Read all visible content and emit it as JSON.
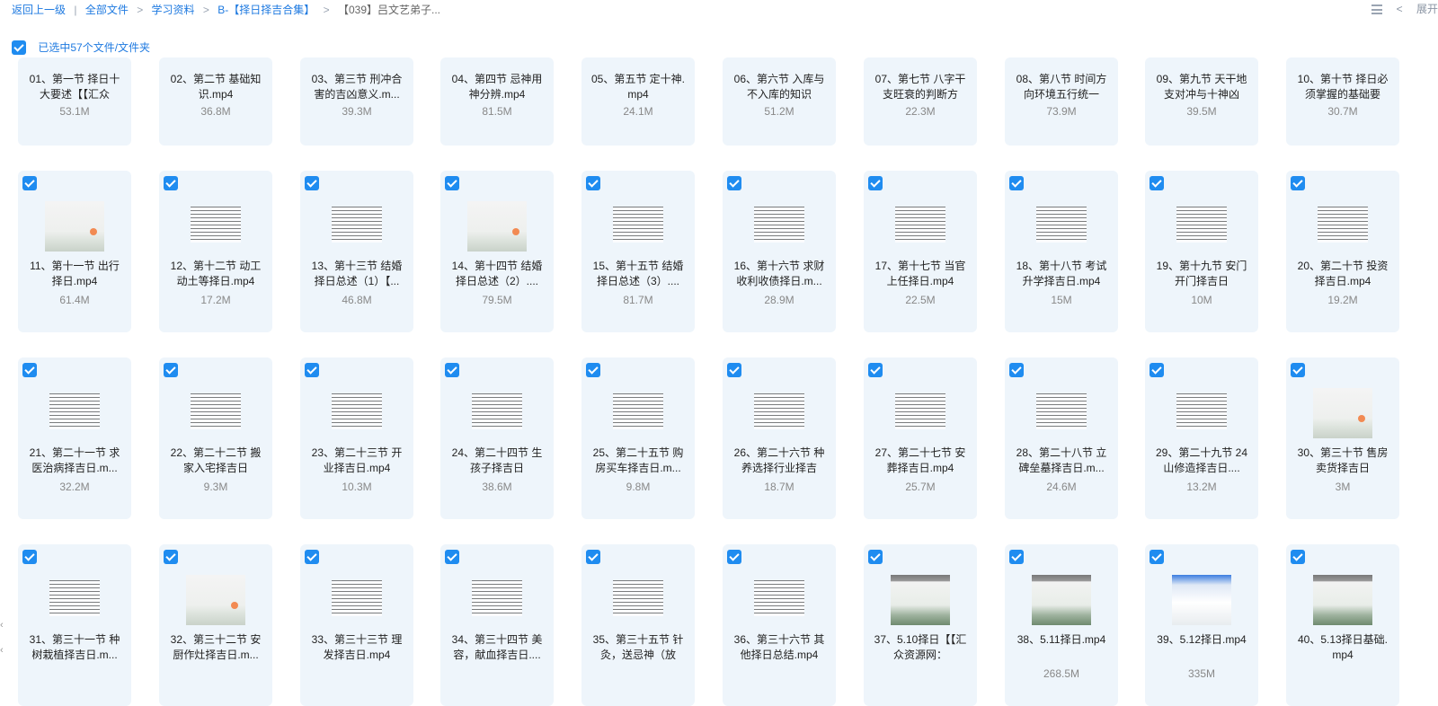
{
  "breadcrumb": {
    "back": "返回上一级",
    "items": [
      "全部文件",
      "学习资料",
      "B-【择日择吉合集】"
    ],
    "current": "【039】吕文艺弟子..."
  },
  "toolbar": {
    "back_arrow": "<",
    "expand": "展开"
  },
  "selection": {
    "text": "已选中57个文件/文件夹"
  },
  "colors": {
    "accent": "#1f7ae0",
    "card_bg": "#eef5fb",
    "checkbox": "#1f8cf0"
  },
  "files": [
    {
      "name": "01、第一节 择日十大要述【【汇众",
      "size": "53.1M",
      "thumb": "none"
    },
    {
      "name": "02、第二节 基础知识.mp4",
      "size": "36.8M",
      "thumb": "none"
    },
    {
      "name": "03、第三节 刑冲合害的吉凶意义.m...",
      "size": "39.3M",
      "thumb": "none"
    },
    {
      "name": "04、第四节 忌神用神分辨.mp4",
      "size": "81.5M",
      "thumb": "none"
    },
    {
      "name": "05、第五节 定十神.mp4",
      "size": "24.1M",
      "thumb": "none"
    },
    {
      "name": "06、第六节 入库与不入库的知识",
      "size": "51.2M",
      "thumb": "none"
    },
    {
      "name": "07、第七节 八字干支旺衰的判断方",
      "size": "22.3M",
      "thumb": "none"
    },
    {
      "name": "08、第八节 时间方向环境五行统一",
      "size": "73.9M",
      "thumb": "none"
    },
    {
      "name": "09、第九节 天干地支对冲与十神凶",
      "size": "39.5M",
      "thumb": "none"
    },
    {
      "name": "10、第十节 择日必须掌握的基础要",
      "size": "30.7M",
      "thumb": "none"
    },
    {
      "name": "11、第十一节 出行择日.mp4",
      "size": "61.4M",
      "thumb": "pic"
    },
    {
      "name": "12、第十二节 动工动土等择日.mp4",
      "size": "17.2M",
      "thumb": "text"
    },
    {
      "name": "13、第十三节 结婚择日总述（1）【...",
      "size": "46.8M",
      "thumb": "text"
    },
    {
      "name": "14、第十四节 结婚择日总述（2）....",
      "size": "79.5M",
      "thumb": "pic"
    },
    {
      "name": "15、第十五节 结婚择日总述（3）....",
      "size": "81.7M",
      "thumb": "text"
    },
    {
      "name": "16、第十六节 求财收利收债择日.m...",
      "size": "28.9M",
      "thumb": "text"
    },
    {
      "name": "17、第十七节 当官上任择日.mp4",
      "size": "22.5M",
      "thumb": "text"
    },
    {
      "name": "18、第十八节 考试升学择吉日.mp4",
      "size": "15M",
      "thumb": "text"
    },
    {
      "name": "19、第十九节 安门开门择吉日",
      "size": "10M",
      "thumb": "text"
    },
    {
      "name": "20、第二十节 投资择吉日.mp4",
      "size": "19.2M",
      "thumb": "text"
    },
    {
      "name": "21、第二十一节 求医治病择吉日.m...",
      "size": "32.2M",
      "thumb": "text"
    },
    {
      "name": "22、第二十二节 搬家入宅择吉日",
      "size": "9.3M",
      "thumb": "text"
    },
    {
      "name": "23、第二十三节 开业择吉日.mp4",
      "size": "10.3M",
      "thumb": "text"
    },
    {
      "name": "24、第二十四节 生孩子择吉日",
      "size": "38.6M",
      "thumb": "text"
    },
    {
      "name": "25、第二十五节 购房买车择吉日.m...",
      "size": "9.8M",
      "thumb": "text"
    },
    {
      "name": "26、第二十六节 种养选择行业择吉",
      "size": "18.7M",
      "thumb": "text"
    },
    {
      "name": "27、第二十七节 安葬择吉日.mp4",
      "size": "25.7M",
      "thumb": "text"
    },
    {
      "name": "28、第二十八节 立碑垒墓择吉日.m...",
      "size": "24.6M",
      "thumb": "text"
    },
    {
      "name": "29、第二十九节 24山修造择吉日....",
      "size": "13.2M",
      "thumb": "text"
    },
    {
      "name": "30、第三十节 售房卖货择吉日",
      "size": "3M",
      "thumb": "pic"
    },
    {
      "name": "31、第三十一节 种树栽植择吉日.m...",
      "size": "",
      "thumb": "text"
    },
    {
      "name": "32、第三十二节 安厨作灶择吉日.m...",
      "size": "",
      "thumb": "pic"
    },
    {
      "name": "33、第三十三节 理发择吉日.mp4",
      "size": "",
      "thumb": "text"
    },
    {
      "name": "34、第三十四节 美容，献血择吉日....",
      "size": "",
      "thumb": "text"
    },
    {
      "name": "35、第三十五节 针灸，送忌神（放",
      "size": "",
      "thumb": "text"
    },
    {
      "name": "36、第三十六节 其他择日总结.mp4",
      "size": "",
      "thumb": "text"
    },
    {
      "name": "37、5.10择日【【汇众资源网：",
      "size": "",
      "thumb": "mountains"
    },
    {
      "name": "38、5.11择日.mp4",
      "size": "268.5M",
      "thumb": "mountains"
    },
    {
      "name": "39、5.12择日.mp4",
      "size": "335M",
      "thumb": "screen"
    },
    {
      "name": "40、5.13择日基础.mp4",
      "size": "",
      "thumb": "mountains"
    }
  ]
}
